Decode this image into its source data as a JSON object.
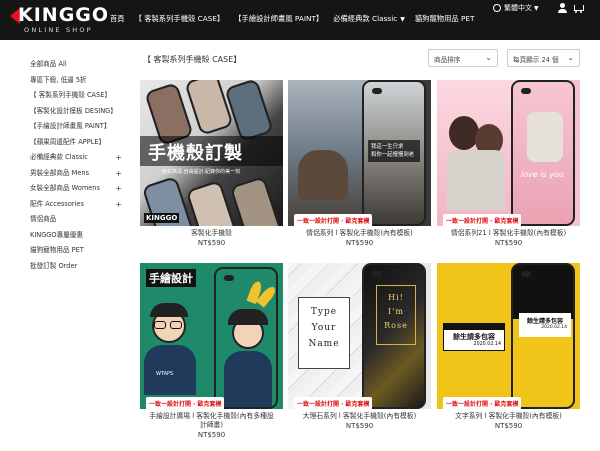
{
  "brand": {
    "name": "KINGGO",
    "tagline": "ONLINE SHOP",
    "accent": "#e8102a"
  },
  "nav": {
    "items": [
      {
        "label": "首頁",
        "has_dropdown": false
      },
      {
        "label": "【 客製系列手機殼 CASE】",
        "has_dropdown": false
      },
      {
        "label": "【手繪設計師畫風 PAINT】",
        "has_dropdown": false
      },
      {
        "label": "必備經典款 Classic",
        "has_dropdown": true
      },
      {
        "label": "貓狗寵物用品 PET",
        "has_dropdown": false
      }
    ],
    "language": "繁體中文"
  },
  "sidebar": {
    "items": [
      {
        "label": "全部商品 All",
        "has_plus": false
      },
      {
        "label": "專區下殺, 低逼 5折",
        "has_plus": false
      },
      {
        "label": "【 客製系列手機殼 CASE】",
        "has_plus": false
      },
      {
        "label": "【客製化設計模板 DESING】",
        "has_plus": false
      },
      {
        "label": "【手繪設計師畫風 PAINT】",
        "has_plus": false
      },
      {
        "label": "【蘋果周邊配件 APPLE】",
        "has_plus": false
      },
      {
        "label": "必備經典款 Classic",
        "has_plus": true
      },
      {
        "label": "男裝全部商品 Mens",
        "has_plus": true
      },
      {
        "label": "女裝全部商品 Womens",
        "has_plus": true
      },
      {
        "label": "配件 Accessories",
        "has_plus": true
      },
      {
        "label": "情侶商品",
        "has_plus": false
      },
      {
        "label": "KINGGO專屬優惠",
        "has_plus": false
      },
      {
        "label": "貓狗寵物用品 PET",
        "has_plus": false
      },
      {
        "label": "批發訂製 Order",
        "has_plus": false
      }
    ]
  },
  "main": {
    "category_title": "【 客製系列手機殼 CASE】",
    "sort_label": "商品排序",
    "perpage_label": "每頁顯示 24 個",
    "products": [
      {
        "name": "客製化手機殼",
        "price": "NT$590",
        "thumb_text": "手機殼訂製",
        "thumb_sub": "色彩高清.自由設計.紀錄你的美一刻",
        "thumb_logo": "KINGGO"
      },
      {
        "name": "情侶系列 l 客製化手機殼(內有模板)",
        "price": "NT$590",
        "thumb_text": "我這一生只求\n和你一起慢慢到老",
        "thumb_sub": "一致一設計打開 · 歐克套模"
      },
      {
        "name": "情侶系列21 l 客製化手機殼(內有模板)",
        "price": "NT$590",
        "thumb_text": "love is you",
        "thumb_sub": "一致一設計打開 · 歐克套模"
      },
      {
        "name": "手繪設計廣場 l 客製化手機殼(內有多種設計師畫)",
        "price": "NT$590",
        "thumb_text": "手繪設計",
        "thumb_sub": "一致一設計打開 · 歐克套模",
        "shirt_text": "WTAPS"
      },
      {
        "name": "大理石系列 l 客製化手機殼(內有模板)",
        "price": "NT$590",
        "thumb_text": "Type\nYour\nName",
        "thumb_text2": "Hi!\nI'm\nRose",
        "thumb_sub": "一致一設計打開 · 歐克套模"
      },
      {
        "name": "文字系列 l 客製化手機殼(內有模板)",
        "price": "NT$590",
        "thumb_text": "餘生請多包容",
        "thumb_date": "2020.02.14",
        "thumb_sub": "一致一設計打開 · 歐克套模"
      }
    ]
  }
}
